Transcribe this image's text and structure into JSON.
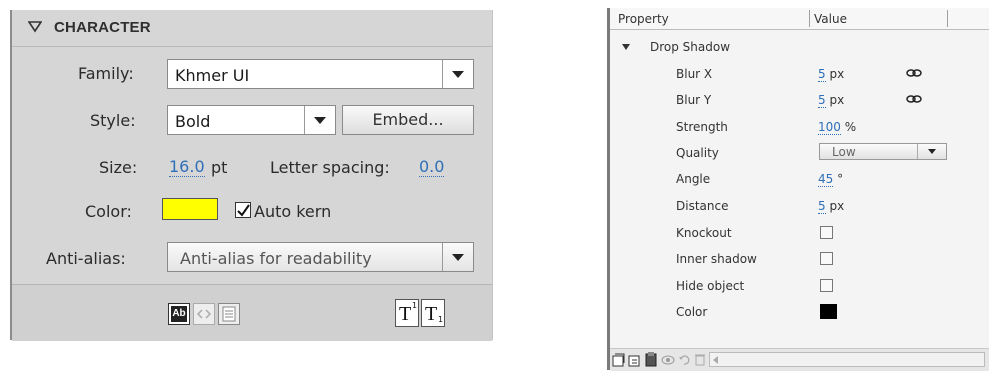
{
  "character_panel": {
    "title": "CHARACTER",
    "family": {
      "label": "Family:",
      "value": "Khmer UI"
    },
    "style": {
      "label": "Style:",
      "value": "Bold",
      "embed_button": "Embed..."
    },
    "size": {
      "label": "Size:",
      "value": "16.0",
      "unit": "pt"
    },
    "letter_spacing": {
      "label": "Letter spacing:",
      "value": "0.0"
    },
    "color": {
      "label": "Color:",
      "swatch": "#ffff00"
    },
    "auto_kern": {
      "label": "Auto kern",
      "checked": true
    },
    "anti_alias": {
      "label": "Anti-alias:",
      "value": "Anti-alias for readability"
    },
    "footer_icons": [
      "selectable-text-icon",
      "show-border-icon",
      "render-html-icon",
      "superscript-icon",
      "subscript-icon"
    ]
  },
  "property_grid": {
    "headers": {
      "property": "Property",
      "value": "Value"
    },
    "group": "Drop Shadow",
    "rows": {
      "blur_x": {
        "label": "Blur X",
        "value": "5",
        "unit": "px"
      },
      "blur_y": {
        "label": "Blur Y",
        "value": "5",
        "unit": "px"
      },
      "strength": {
        "label": "Strength",
        "value": "100",
        "unit": "%"
      },
      "quality": {
        "label": "Quality",
        "value": "Low"
      },
      "angle": {
        "label": "Angle",
        "value": "45",
        "unit": "°"
      },
      "distance": {
        "label": "Distance",
        "value": "5",
        "unit": "px"
      },
      "knockout": {
        "label": "Knockout",
        "checked": false
      },
      "inner_shadow": {
        "label": "Inner shadow",
        "checked": false
      },
      "hide_object": {
        "label": "Hide object",
        "checked": false
      },
      "color": {
        "label": "Color",
        "swatch": "#000000"
      }
    },
    "toolbar_icons": [
      "add-filter-icon",
      "preset-icon",
      "clipboard-icon",
      "enable-filter-icon",
      "reset-filter-icon",
      "delete-filter-icon"
    ]
  }
}
